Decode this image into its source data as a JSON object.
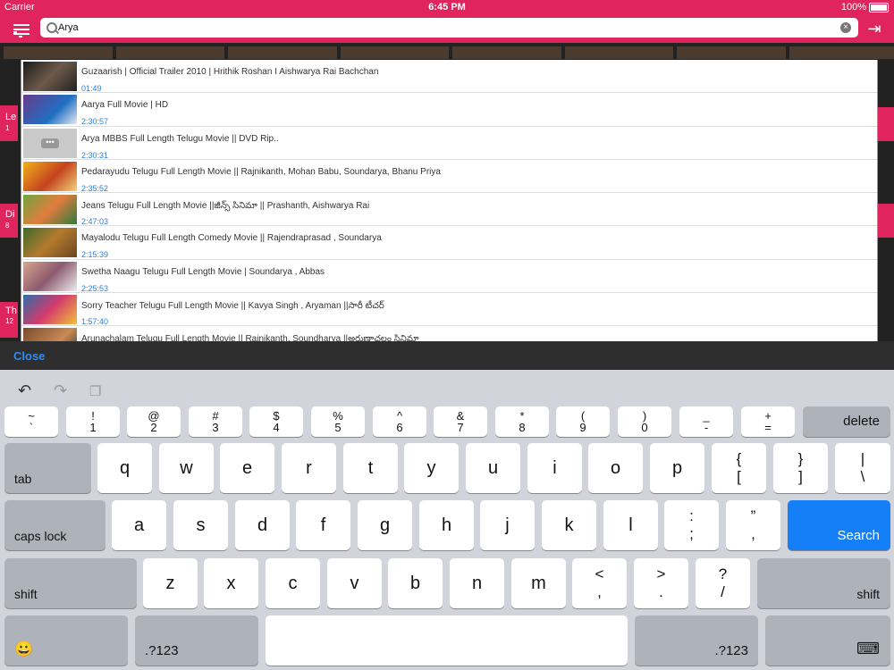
{
  "status": {
    "carrier": "Carrier",
    "time": "6:45 PM",
    "battery": "100%"
  },
  "search": {
    "value": "Arya"
  },
  "icons": {
    "menu": "menu-icon",
    "login": "login-icon",
    "clear": "clear-icon"
  },
  "background": {
    "letters": [
      "Le",
      "1",
      "Di",
      "8",
      "Th",
      "12"
    ]
  },
  "results": [
    {
      "title": "Guzaarish | Official Trailer 2010 | Hrithik Roshan I Aishwarya Rai Bachchan",
      "duration": "01:49"
    },
    {
      "title": "Aarya Full Movie | HD",
      "duration": "2:30:57"
    },
    {
      "title": "Arya MBBS Full Length Telugu Movie || DVD Rip..",
      "duration": "2:30:31"
    },
    {
      "title": "Pedarayudu Telugu Full Length Movie || Rajnikanth, Mohan Babu, Soundarya, Bhanu Priya",
      "duration": "2:35:52"
    },
    {
      "title": "Jeans Telugu Full Length Movie ||జీన్స్ సినిమా || Prashanth, Aishwarya Rai",
      "duration": "2:47:03"
    },
    {
      "title": "Mayalodu Telugu Full Length Comedy Movie || Rajendraprasad , Soundarya",
      "duration": "2:15:39"
    },
    {
      "title": "Swetha Naagu Telugu Full Length Movie | Soundarya , Abbas",
      "duration": "2:25:53"
    },
    {
      "title": "Sorry Teacher Telugu Full Length Movie || Kavya Singh , Aryaman ||సారీ టీచర్",
      "duration": "1:57:40"
    },
    {
      "title": "Arunachalam Telugu Full Length Movie || Rajnikanth, Soundharya ||అరుణాచలం సినిమా",
      "duration": ""
    }
  ],
  "close_label": "Close",
  "keyboard": {
    "num_row": [
      {
        "top": "~",
        "bot": "`"
      },
      {
        "top": "!",
        "bot": "1"
      },
      {
        "top": "@",
        "bot": "2"
      },
      {
        "top": "#",
        "bot": "3"
      },
      {
        "top": "$",
        "bot": "4"
      },
      {
        "top": "%",
        "bot": "5"
      },
      {
        "top": "^",
        "bot": "6"
      },
      {
        "top": "&",
        "bot": "7"
      },
      {
        "top": "*",
        "bot": "8"
      },
      {
        "top": "(",
        "bot": "9"
      },
      {
        "top": ")",
        "bot": "0"
      },
      {
        "top": "_",
        "bot": "-"
      },
      {
        "top": "+",
        "bot": "="
      }
    ],
    "delete": "delete",
    "tab": "tab",
    "row1": [
      "q",
      "w",
      "e",
      "r",
      "t",
      "y",
      "u",
      "i",
      "o",
      "p"
    ],
    "row1_extra": [
      {
        "top": "{",
        "bot": "["
      },
      {
        "top": "}",
        "bot": "]"
      },
      {
        "top": "|",
        "bot": "\\"
      }
    ],
    "caps": "caps lock",
    "row2": [
      "a",
      "s",
      "d",
      "f",
      "g",
      "h",
      "j",
      "k",
      "l"
    ],
    "row2_extra": [
      {
        "top": ":",
        "bot": ";"
      },
      {
        "top": "”",
        "bot": ","
      }
    ],
    "search": "Search",
    "shift": "shift",
    "row3": [
      "z",
      "x",
      "c",
      "v",
      "b",
      "n",
      "m"
    ],
    "row3_extra": [
      {
        "top": "<",
        "bot": ","
      },
      {
        "top": ">",
        "bot": "."
      },
      {
        "top": "?",
        "bot": "/"
      }
    ],
    "numbers": ".?123",
    "emoji": "😀",
    "hide": "⌨"
  },
  "colors": {
    "accent": "#e0245e",
    "link": "#2f8cf0",
    "search_key": "#157ff8"
  }
}
